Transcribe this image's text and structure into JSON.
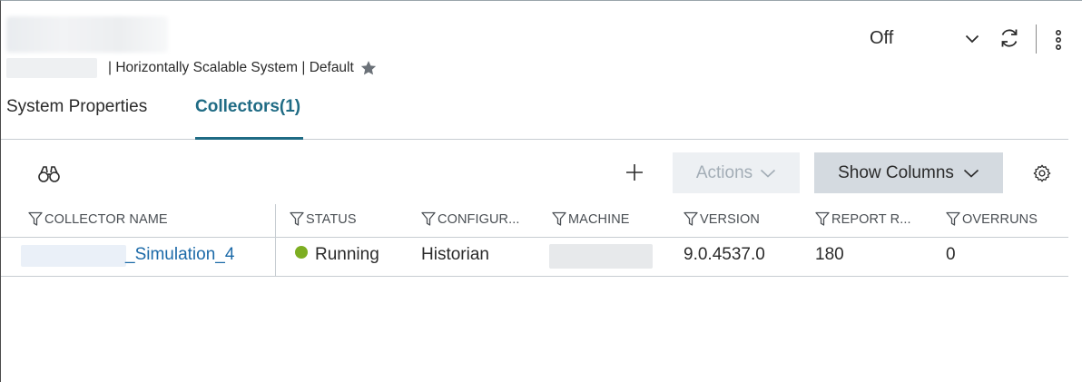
{
  "header": {
    "subtitle": "| Horizontally Scalable System | Default",
    "mode_value": "Off",
    "icons": [
      "star-icon",
      "chevron-down-icon",
      "refresh-icon",
      "more-vertical-icon"
    ]
  },
  "tabs": [
    {
      "label": "System Properties",
      "active": false
    },
    {
      "label": "Collectors(1)",
      "active": true
    }
  ],
  "toolbar": {
    "actions_label": "Actions",
    "show_columns_label": "Show Columns",
    "icons": [
      "binoculars-icon",
      "plus-icon",
      "gear-icon"
    ]
  },
  "table": {
    "columns": [
      "COLLECTOR NAME",
      "STATUS",
      "CONFIGUR...",
      "MACHINE",
      "VERSION",
      " REPORT R...",
      " OVERRUNS"
    ],
    "rows": [
      {
        "collector_name": "_Simulation_4",
        "status": "Running",
        "configuration": "Historian",
        "version": "9.0.4537.0",
        "report_rate": "180",
        "overruns": "0"
      }
    ]
  },
  "colors": {
    "accent": "#1f6b84",
    "link": "#1c6aa8",
    "status_running": "#7dae22",
    "disabled_button_bg": "#edf0f3",
    "button_bg": "#d4dae0"
  }
}
